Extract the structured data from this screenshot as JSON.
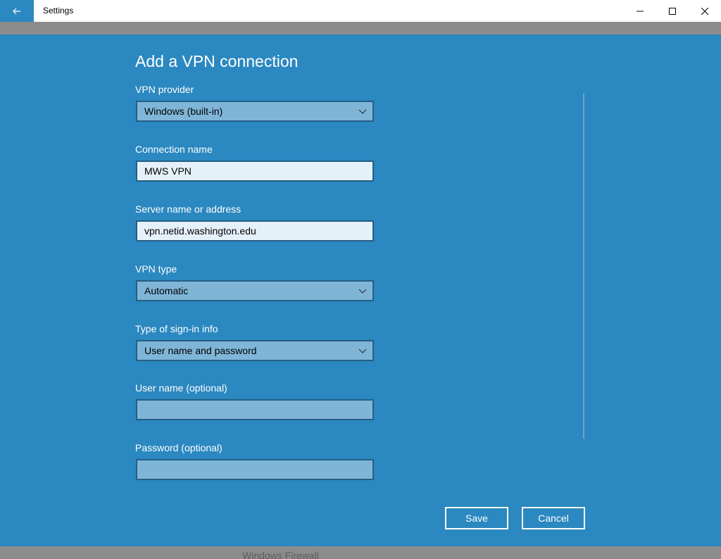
{
  "window": {
    "title": "Settings",
    "icons": {
      "back": "back-arrow-icon",
      "minimize": "minimize-icon",
      "maximize": "maximize-icon",
      "close": "close-icon"
    }
  },
  "dialog": {
    "heading": "Add a VPN connection",
    "vpn_provider": {
      "label": "VPN provider",
      "value": "Windows (built-in)"
    },
    "connection_name": {
      "label": "Connection name",
      "value": "MWS VPN"
    },
    "server": {
      "label": "Server name or address",
      "value": "vpn.netid.washington.edu"
    },
    "vpn_type": {
      "label": "VPN type",
      "value": "Automatic"
    },
    "signin_type": {
      "label": "Type of sign-in info",
      "value": "User name and password"
    },
    "username": {
      "label": "User name (optional)",
      "value": ""
    },
    "password": {
      "label": "Password (optional)",
      "value": ""
    },
    "save_label": "Save",
    "cancel_label": "Cancel"
  },
  "background": {
    "partial_text": "Windows Firewall"
  },
  "colors": {
    "accent": "#2b88c0",
    "field": "#7fb6d8",
    "field_text": "#e5f1f8"
  }
}
